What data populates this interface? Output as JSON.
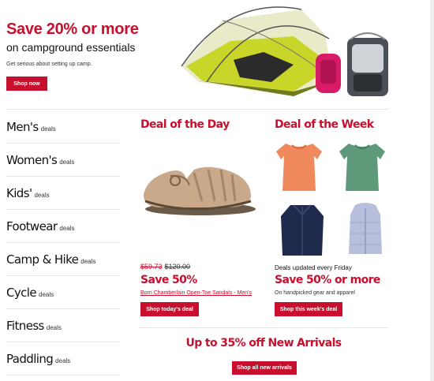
{
  "hero": {
    "title": "Save 20% or more",
    "subtitle": "on campground essentials",
    "description": "Get serious about setting up camp.",
    "button_label": "Shop now"
  },
  "sidebar": {
    "items": [
      {
        "main": "Men's",
        "sub": "deals"
      },
      {
        "main": "Women's",
        "sub": "deals"
      },
      {
        "main": "Kids'",
        "sub": "deals"
      },
      {
        "main": "Footwear",
        "sub": "deals"
      },
      {
        "main": "Camp & Hike",
        "sub": "deals"
      },
      {
        "main": "Cycle",
        "sub": "deals"
      },
      {
        "main": "Fitness",
        "sub": "deals"
      },
      {
        "main": "Paddling",
        "sub": "deals"
      }
    ]
  },
  "deal_of_day": {
    "title": "Deal of the Day",
    "sale_price": "$59.73",
    "original_price": "$120.00",
    "save_text": "Save 50%",
    "product_link": "Born Chamberlain Open-Toe Sandals - Men's",
    "button_label": "Shop today's deal"
  },
  "deal_of_week": {
    "title": "Deal of the Week",
    "updated_text": "Deals updated every Friday",
    "save_text": "Save 50% or more",
    "description": "On handpicked gear and apparel",
    "button_label": "Shop this week's deal"
  },
  "new_arrivals": {
    "title": "Up to 35% off New Arrivals",
    "button_label": "Shop all new arrivals"
  },
  "colors": {
    "accent": "#c8102e",
    "tent_green": "#c8d62a",
    "orange_top": "#f08a5d",
    "green_top": "#5e9a7a",
    "navy_jacket": "#1f2a4d",
    "lavender_vest": "#b7bfdc"
  },
  "icons": {
    "hero": "tent-and-backpacks-image",
    "deal_of_day": "sandal-image",
    "deal_of_week": [
      "orange-top-image",
      "green-top-image",
      "navy-jacket-image",
      "lavender-vest-image"
    ]
  }
}
